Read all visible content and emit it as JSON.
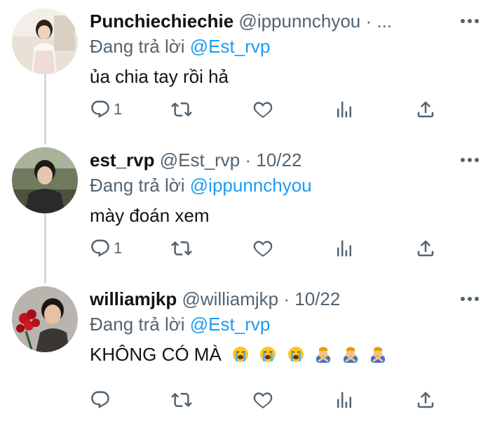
{
  "tweets": [
    {
      "name": "Punchiechiechie",
      "handle": "@ippunnchyou · ...",
      "reply_prefix": "Đang trả lời ",
      "reply_to": "@Est_rvp",
      "text": "ủa chia tay rồi hả",
      "reply_count": "1"
    },
    {
      "name": "est_rvp",
      "handle": "@Est_rvp · 10/22",
      "reply_prefix": "Đang trả lời ",
      "reply_to": "@ippunnchyou",
      "text": "mày đoán xem",
      "reply_count": "1"
    },
    {
      "name": "williamjkp",
      "handle": "@williamjkp · 10/22",
      "reply_prefix": "Đang trả lời ",
      "reply_to": "@Est_rvp",
      "text": "KHÔNG CÓ MÀ",
      "emojis": [
        "loudly-crying-face",
        "loudly-crying-face",
        "loudly-crying-face",
        "person-gesturing-no",
        "person-gesturing-no",
        "person-gesturing-no"
      ],
      "reply_count": ""
    }
  ],
  "colors": {
    "text": "#0f1419",
    "secondary": "#536471",
    "mention": "#1d9bf0",
    "thread_line": "#cfd9de"
  }
}
